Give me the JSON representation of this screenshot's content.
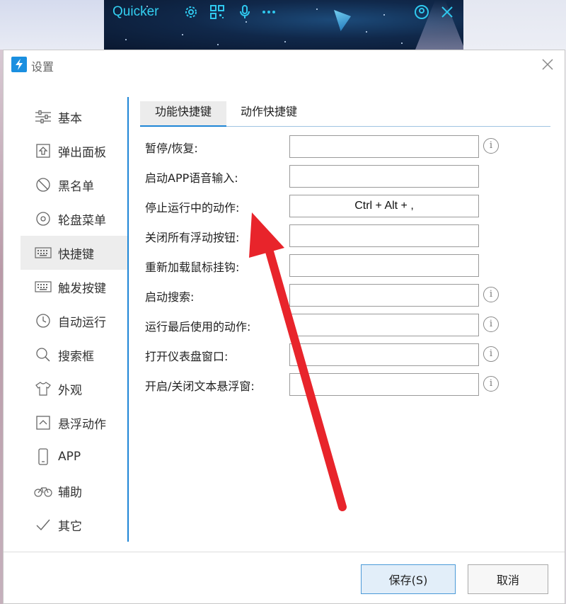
{
  "quicker": {
    "logo": "Quicker",
    "icons": [
      "gear-icon",
      "qr-code-icon",
      "microphone-icon",
      "more-icon",
      "user-circle-icon",
      "close-icon"
    ]
  },
  "window": {
    "title": "设置",
    "accent_color": "#1e86d6"
  },
  "sidebar": {
    "items": [
      {
        "label": "基本",
        "icon": "sliders-icon"
      },
      {
        "label": "弹出面板",
        "icon": "popup-panel-icon"
      },
      {
        "label": "黑名单",
        "icon": "blocked-icon"
      },
      {
        "label": "轮盘菜单",
        "icon": "wheel-menu-icon"
      },
      {
        "label": "快捷键",
        "icon": "keyboard-icon",
        "active": true
      },
      {
        "label": "触发按键",
        "icon": "keyboard-icon"
      },
      {
        "label": "自动运行",
        "icon": "clock-icon"
      },
      {
        "label": "搜索框",
        "icon": "search-icon"
      },
      {
        "label": "外观",
        "icon": "tshirt-icon"
      },
      {
        "label": "悬浮动作",
        "icon": "floating-action-icon"
      },
      {
        "label": "APP",
        "icon": "phone-icon"
      },
      {
        "label": "辅助",
        "icon": "bicycle-icon"
      },
      {
        "label": "其它",
        "icon": "check-icon"
      }
    ]
  },
  "tabs": [
    {
      "label": "功能快捷键",
      "active": true
    },
    {
      "label": "动作快捷键",
      "active": false
    }
  ],
  "shortcuts": [
    {
      "label": "暂停/恢复:",
      "value": "",
      "info": true
    },
    {
      "label": "启动APP语音输入:",
      "value": "",
      "info": false
    },
    {
      "label": "停止运行中的动作:",
      "value": "Ctrl + Alt + ,",
      "info": false
    },
    {
      "label": "关闭所有浮动按钮:",
      "value": "",
      "info": false
    },
    {
      "label": "重新加载鼠标挂钩:",
      "value": "",
      "info": false
    },
    {
      "label": "启动搜索:",
      "value": "",
      "info": true
    },
    {
      "label": "运行最后使用的动作:",
      "value": "",
      "info": true
    },
    {
      "label": "打开仪表盘窗口:",
      "value": "",
      "info": true
    },
    {
      "label": "开启/关闭文本悬浮窗:",
      "value": "",
      "info": true
    }
  ],
  "info_glyph": "i",
  "buttons": {
    "save": "保存(S)",
    "cancel": "取消"
  },
  "annotation": {
    "arrow_color": "#e8242b"
  }
}
